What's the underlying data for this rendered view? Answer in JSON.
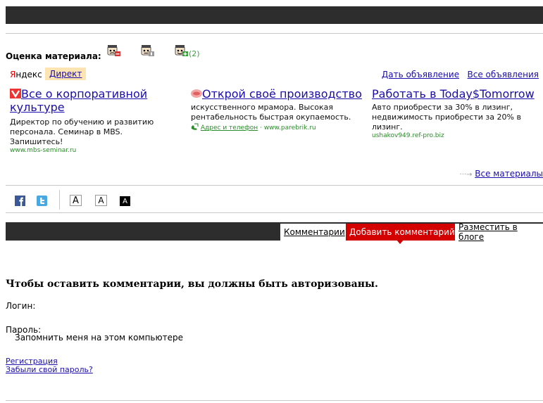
{
  "rating": {
    "label": "Оценка материала:",
    "positive_count": "(2)",
    "colors": {
      "negative": "#d43a3a",
      "neutral": "#999999",
      "positive": "#3aa03a"
    }
  },
  "ads": {
    "brand_ya": "Я",
    "brand_rest": "ндекс",
    "direct_label": "Директ",
    "place_ad": "Дать объявление",
    "all_ads": "Все объявления",
    "items": [
      {
        "title": "Все о корпоративной культуре",
        "text": "Директор по обучению и развитию персонала. Семинар в MBS. Запишитесь!",
        "url": "www.mbs-seminar.ru",
        "icon": "red-favicon"
      },
      {
        "title": "Открой своё производство",
        "text": "искусственного мрамора. Высокая рентабельность быстрая окупаемость.",
        "contact_label": "Адрес и телефон",
        "sep": "·",
        "url": "www.parebrik.ru",
        "icon": "pink-favicon"
      },
      {
        "title": "Работать в Today$Tomorrow",
        "text": "Авто приобрести за 30% в лизинг, недвижимость приобрести за 20% в лизинг.",
        "url": "ushakov949.ref-pro.biz"
      }
    ]
  },
  "all_materials": {
    "arrow": "···→",
    "label": "Все материалы"
  },
  "font_buttons": [
    "A",
    "A",
    "A"
  ],
  "comments_tabs": [
    "Комментарии",
    "Добавить комментарий",
    "Разместить в блоге"
  ],
  "form": {
    "title": "Чтобы оставить комментарии, вы должны быть авторизованы.",
    "login_label": "Логин:",
    "password_label": "Пароль:",
    "remember_label": "Запомнить меня на этом компьютере",
    "register_link": "Регистрация",
    "forgot_link": "Забыли свой пароль?"
  }
}
